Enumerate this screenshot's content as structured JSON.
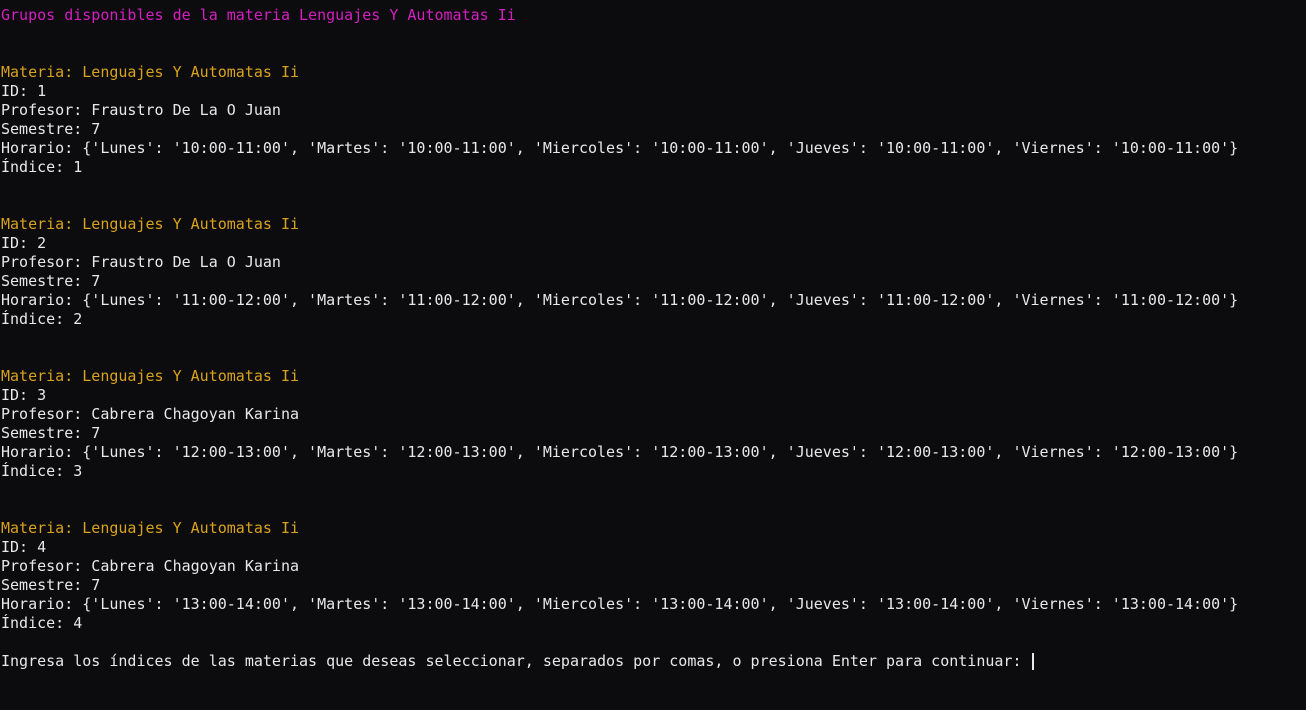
{
  "terminal": {
    "heading": "Grupos disponibles de la materia Lenguajes Y Automatas Ii",
    "groups": [
      {
        "materia": "Materia: Lenguajes Y Automatas Ii",
        "id": "ID: 1",
        "profesor": "Profesor: Fraustro De La O Juan",
        "semestre": "Semestre: 7",
        "horario": "Horario: {'Lunes': '10:00-11:00', 'Martes': '10:00-11:00', 'Miercoles': '10:00-11:00', 'Jueves': '10:00-11:00', 'Viernes': '10:00-11:00'}",
        "indice": "Índice: 1"
      },
      {
        "materia": "Materia: Lenguajes Y Automatas Ii",
        "id": "ID: 2",
        "profesor": "Profesor: Fraustro De La O Juan",
        "semestre": "Semestre: 7",
        "horario": "Horario: {'Lunes': '11:00-12:00', 'Martes': '11:00-12:00', 'Miercoles': '11:00-12:00', 'Jueves': '11:00-12:00', 'Viernes': '11:00-12:00'}",
        "indice": "Índice: 2"
      },
      {
        "materia": "Materia: Lenguajes Y Automatas Ii",
        "id": "ID: 3",
        "profesor": "Profesor: Cabrera Chagoyan Karina",
        "semestre": "Semestre: 7",
        "horario": "Horario: {'Lunes': '12:00-13:00', 'Martes': '12:00-13:00', 'Miercoles': '12:00-13:00', 'Jueves': '12:00-13:00', 'Viernes': '12:00-13:00'}",
        "indice": "Índice: 3"
      },
      {
        "materia": "Materia: Lenguajes Y Automatas Ii",
        "id": "ID: 4",
        "profesor": "Profesor: Cabrera Chagoyan Karina",
        "semestre": "Semestre: 7",
        "horario": "Horario: {'Lunes': '13:00-14:00', 'Martes': '13:00-14:00', 'Miercoles': '13:00-14:00', 'Jueves': '13:00-14:00', 'Viernes': '13:00-14:00'}",
        "indice": "Índice: 4"
      }
    ],
    "prompt": "Ingresa los índices de las materias que deseas seleccionar, separados por comas, o presiona Enter para continuar: ",
    "colors": {
      "background": "#0c0c0e",
      "heading": "#d41fc1",
      "materia": "#d8a21c",
      "text": "#e8e8e8"
    }
  }
}
